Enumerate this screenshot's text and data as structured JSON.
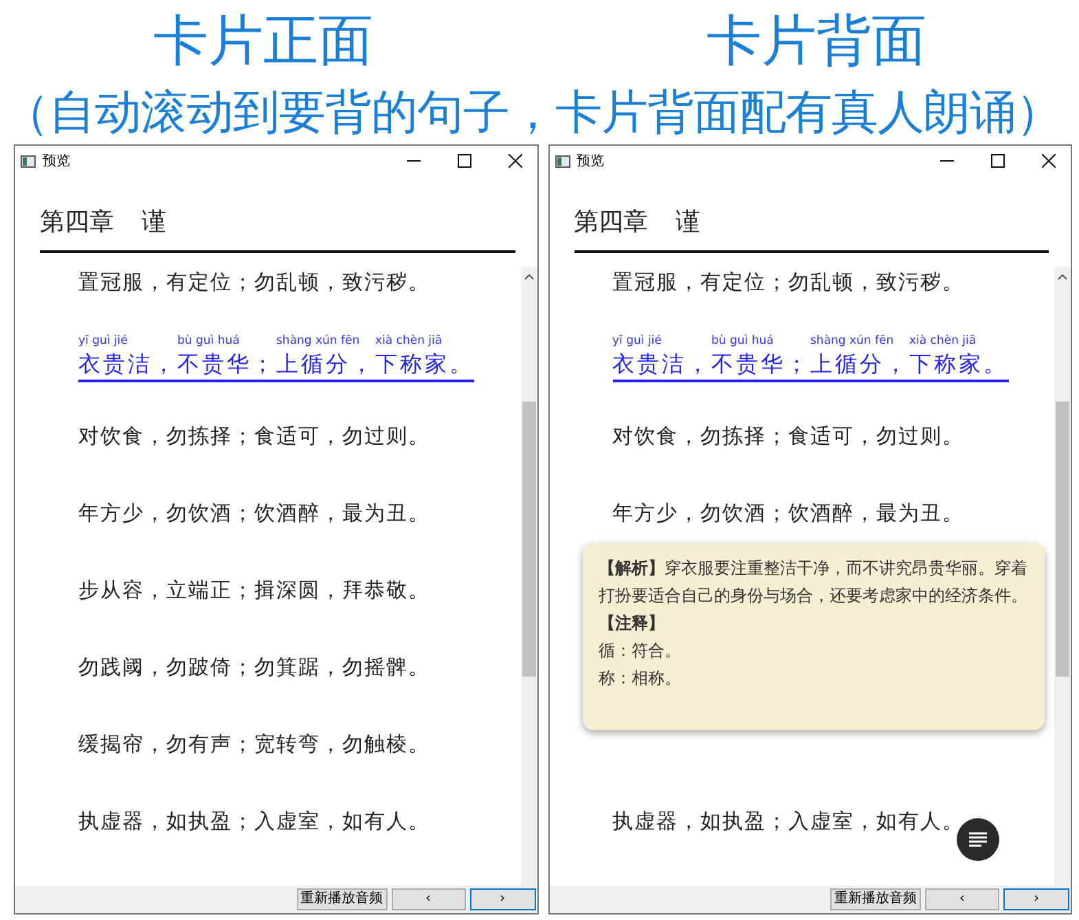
{
  "headings": [
    "卡片正面",
    "卡片背面"
  ],
  "subtitle": "（自动滚动到要背的句子，卡片背面配有真人朗诵）",
  "windows": [
    {
      "title": "预览",
      "chapter": [
        "第四章",
        "谨"
      ],
      "lines": [
        {
          "kind": "plain",
          "text": "置冠服，有定位；勿乱顿，致污秽。"
        },
        {
          "kind": "annotated",
          "text": "衣贵洁，不贵华；上循分，下称家。",
          "pinyin": [
            "yī guì jié",
            "bù guì huá",
            "shàng xún fēn",
            "xià chèn jiā"
          ]
        },
        {
          "kind": "plain",
          "text": "对饮食，勿拣择；食适可，勿过则。"
        },
        {
          "kind": "plain",
          "text": "年方少，勿饮酒；饮酒醉，最为丑。"
        },
        {
          "kind": "plain",
          "text": "步从容，立端正；揖深圆，拜恭敬。"
        },
        {
          "kind": "plain",
          "text": "勿践阈，勿跛倚；勿箕踞，勿摇髀。"
        },
        {
          "kind": "plain",
          "text": "缓揭帘，勿有声；宽转弯，勿触棱。"
        },
        {
          "kind": "plain",
          "text": "执虚器，如执盈；入虚室，如有人。"
        }
      ],
      "menu_button": false,
      "buttons": [
        {
          "label": "重新播放音频",
          "focused": false
        },
        {
          "label": "‹",
          "focused": false
        },
        {
          "label": "›",
          "focused": true
        }
      ]
    },
    {
      "title": "预览",
      "chapter": [
        "第四章",
        "谨"
      ],
      "lines": [
        {
          "kind": "plain",
          "text": "置冠服，有定位；勿乱顿，致污秽。"
        },
        {
          "kind": "annotated",
          "text": "衣贵洁，不贵华；上循分，下称家。",
          "pinyin": [
            "yī guì jié",
            "bù guì huá",
            "shàng xún fēn",
            "xià chèn jiā"
          ]
        },
        {
          "kind": "plain",
          "text": "对饮食，勿拣择；食适可，勿过则。"
        },
        {
          "kind": "plain",
          "text": "年方少，勿饮酒；饮酒醉，最为丑。"
        },
        {
          "kind": "popup"
        },
        {
          "kind": "plain",
          "text": "执虚器，如执盈；入虚室，如有人。"
        }
      ],
      "popup": {
        "analysis": "**【解析】**穿衣服要注重整洁干净，而不讲究昂贵华丽。穿着打扮要适合自己的身份与场合，还要考虑家中的经济条件。",
        "notes_heading": "【注释】",
        "notes": [
          "循：符合。",
          "称：相称。"
        ]
      },
      "menu_button": true,
      "buttons": [
        {
          "label": "重新播放音频",
          "focused": false
        },
        {
          "label": "‹",
          "focused": false
        },
        {
          "label": "›",
          "focused": true
        }
      ]
    }
  ]
}
